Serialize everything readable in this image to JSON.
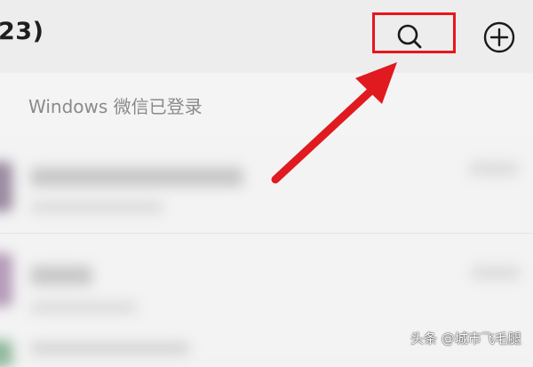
{
  "header": {
    "title": "23)",
    "search_icon": "search-icon",
    "add_icon": "plus-circle-icon"
  },
  "banner": {
    "text": "Windows 微信已登录"
  },
  "annotation": {
    "box_color": "#e8161c",
    "arrow_color": "#e8161c"
  },
  "watermark": {
    "text": "头条 @城市飞毛腿"
  }
}
